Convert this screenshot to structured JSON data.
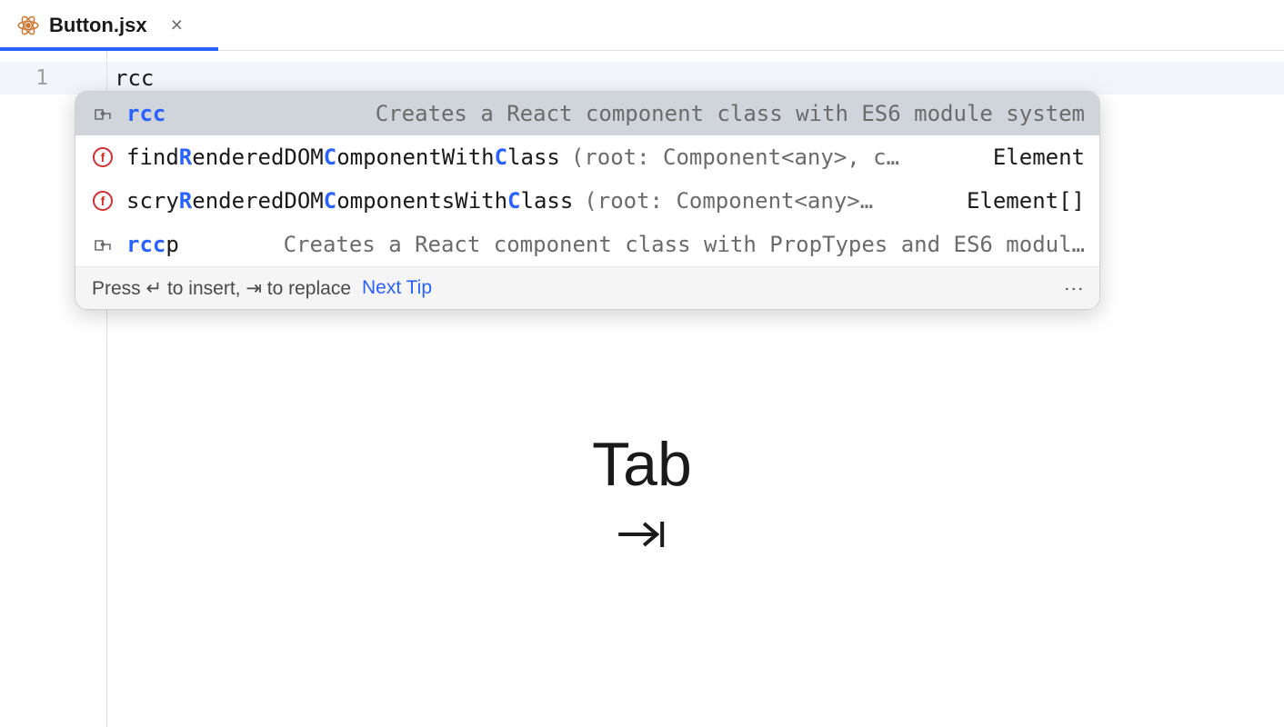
{
  "tab": {
    "filename": "Button.jsx",
    "close_glyph": "×"
  },
  "editor": {
    "line_number": "1",
    "typed_text": "rcc"
  },
  "autocomplete": {
    "items": [
      {
        "kind": "live_template",
        "name": "rcc",
        "description": "Creates a React component class with ES6 module system",
        "selected": true
      },
      {
        "kind": "function",
        "name_parts": [
          "find",
          "R",
          "enderedDOM",
          "C",
          "omponentWith",
          "C",
          "lass"
        ],
        "params": "(root: Component<any>, c…",
        "return_type": "Element"
      },
      {
        "kind": "function",
        "name_parts": [
          "scry",
          "R",
          "enderedDOM",
          "C",
          "omponentsWith",
          "C",
          "lass"
        ],
        "params": "(root: Component<any>…",
        "return_type": "Element[]"
      },
      {
        "kind": "live_template",
        "name": "rcc",
        "suffix": "p",
        "description": "Creates a React component class with PropTypes and ES6 modul…"
      }
    ],
    "footer": {
      "hint_prefix": "Press ",
      "enter_key": "↵",
      "insert_text": " to insert, ",
      "tab_key": "⇥",
      "replace_text": " to replace",
      "next_tip": "Next Tip",
      "menu_glyph": "⋮"
    }
  },
  "overlay": {
    "label": "Tab"
  },
  "icons": {
    "function_letter": "f"
  }
}
